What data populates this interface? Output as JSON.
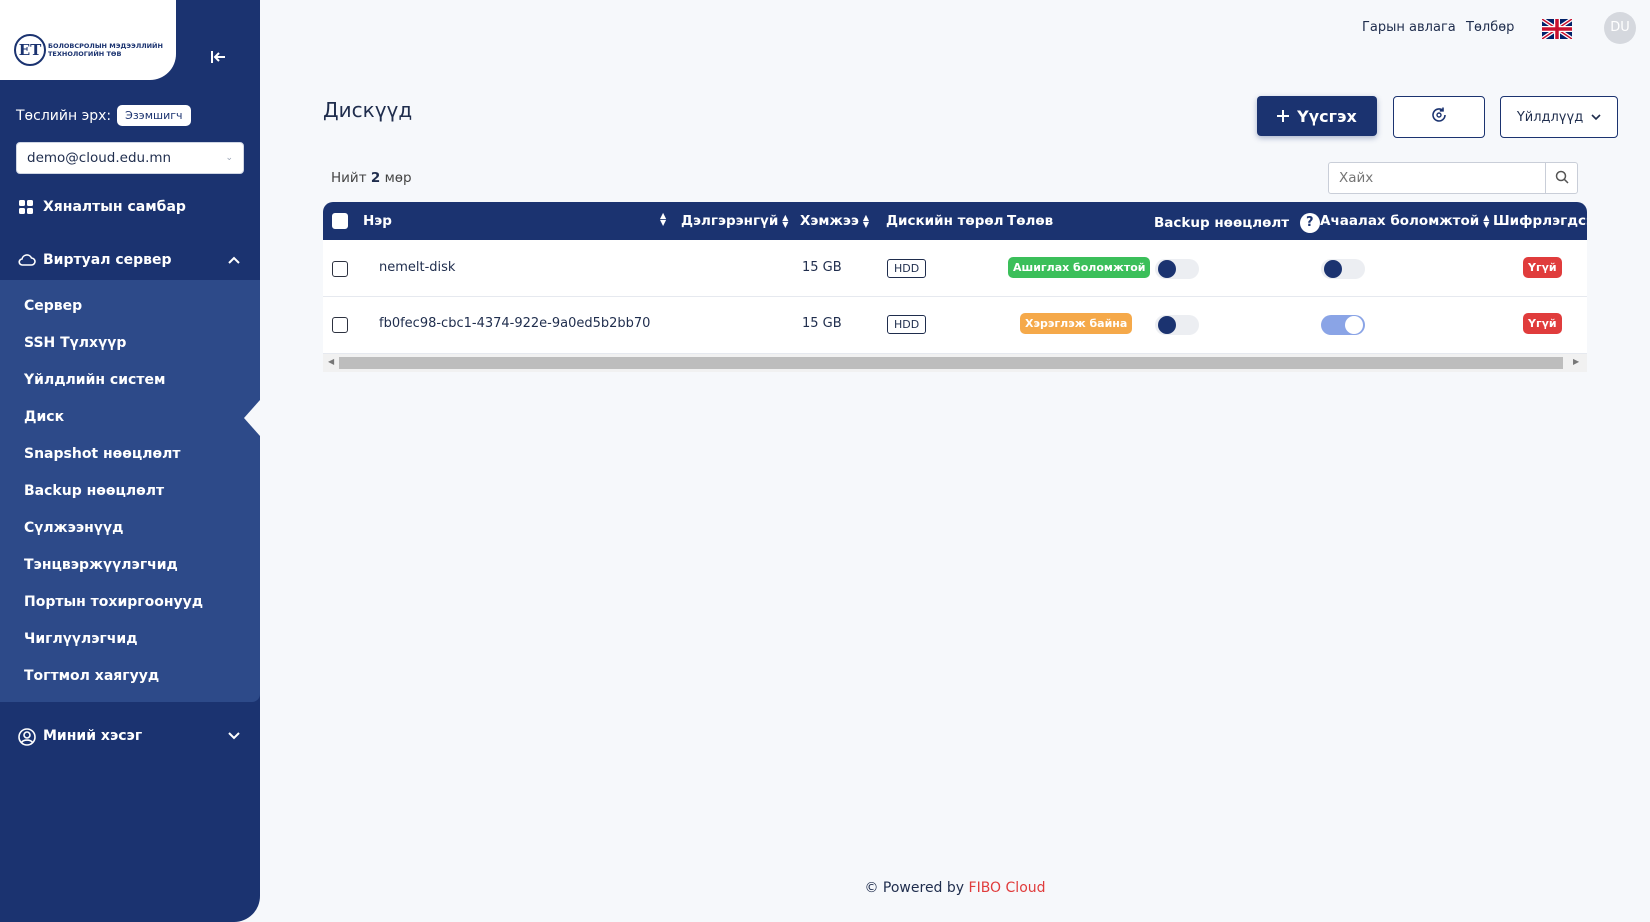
{
  "brand": {
    "logo_mark": "ЕТ",
    "logo_text": "БОЛОВСРОЛЫН МЭДЭЭЛЛИЙН ТЕХНОЛОГИЙН ТӨВ"
  },
  "sidebar": {
    "role_label": "Төслийн эрх:",
    "role_badge": "Эзэмшигч",
    "account": "demo@cloud.edu.mn",
    "dashboard": "Хяналтын самбар",
    "virtual_server": "Виртуал сервер",
    "sub_items": [
      {
        "label": "Сервер"
      },
      {
        "label": "SSH Түлхүүр"
      },
      {
        "label": "Үйлдлийн систем"
      },
      {
        "label": "Диск"
      },
      {
        "label": "Snapshot нөөцлөлт"
      },
      {
        "label": "Backup нөөцлөлт"
      },
      {
        "label": "Сүлжээнүүд"
      },
      {
        "label": "Тэнцвэржүүлэгчид"
      },
      {
        "label": "Портын тохиргоонууд"
      },
      {
        "label": "Чиглүүлэгчид"
      },
      {
        "label": "Тогтмол хаягууд"
      }
    ],
    "my_section": "Миний хэсэг"
  },
  "header": {
    "guide": "Гарын авлага",
    "payment": "Төлбөр",
    "avatar": "DU"
  },
  "main": {
    "title": "Дискүүд",
    "create_button": "Үүсгэх",
    "actions_button": "Үйлдлүүд",
    "total_prefix": "Нийт",
    "total_count": "2",
    "total_suffix": "мөр",
    "search_placeholder": "Хайх"
  },
  "table": {
    "columns": {
      "name": "Нэр",
      "details": "Дэлгэрэнгүй",
      "size": "Хэмжээ",
      "disk_type": "Дискийн төрөл",
      "status": "Төлөв",
      "backup": "Backup нөөцлөлт",
      "bootable": "Ачаалах боломжтой",
      "encrypted": "Шифрлэгдсэн"
    },
    "rows": [
      {
        "name": "nemelt-disk",
        "size": "15 GB",
        "type": "HDD",
        "status": "Ашиглах боломжтой",
        "status_color": "#3bbf5a",
        "backup": false,
        "bootable": false,
        "encrypted": "Үгүй"
      },
      {
        "name": "fb0fec98-cbc1-4374-922e-9a0ed5b2bb70",
        "size": "15 GB",
        "type": "HDD",
        "status": "Хэрэглэж байна",
        "status_color": "#f5a94a",
        "backup": false,
        "bootable": true,
        "encrypted": "Үгүй"
      }
    ]
  },
  "footer": {
    "prefix": "© Powered by",
    "brand": "FIBO Cloud"
  },
  "colors": {
    "primary": "#1b3370",
    "sub_panel": "#2d4a89",
    "danger": "#e03c3c"
  }
}
